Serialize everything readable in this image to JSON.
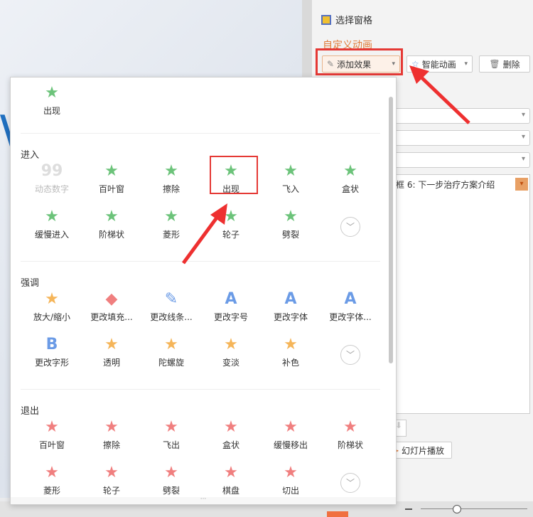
{
  "panel": {
    "select_pane": "选择窗格",
    "custom_animation": "自定义动画",
    "add_effect": "添加效果",
    "smart_animation": "智能动画",
    "delete": "删除",
    "list_item": "框 6: 下一步治疗方案介绍",
    "slideshow": "幻灯片播放"
  },
  "dropdown": {
    "recent": [
      {
        "label": "出现",
        "icon": "star",
        "color": "#6cc37a"
      }
    ],
    "sections": [
      {
        "title": "进入",
        "items": [
          {
            "label": "动态数字",
            "icon": "99"
          },
          {
            "label": "百叶窗",
            "icon": "star"
          },
          {
            "label": "擦除",
            "icon": "star"
          },
          {
            "label": "出现",
            "icon": "star",
            "highlight": true
          },
          {
            "label": "飞入",
            "icon": "star"
          },
          {
            "label": "盒状",
            "icon": "star"
          },
          {
            "label": "缓慢进入",
            "icon": "star"
          },
          {
            "label": "阶梯状",
            "icon": "star"
          },
          {
            "label": "菱形",
            "icon": "star"
          },
          {
            "label": "轮子",
            "icon": "star"
          },
          {
            "label": "劈裂",
            "icon": "star"
          }
        ]
      },
      {
        "title": "强调",
        "items": [
          {
            "label": "放大/缩小",
            "icon": "star"
          },
          {
            "label": "更改填充...",
            "icon": "fill"
          },
          {
            "label": "更改线条...",
            "icon": "pen"
          },
          {
            "label": "更改字号",
            "icon": "A"
          },
          {
            "label": "更改字体",
            "icon": "A"
          },
          {
            "label": "更改字体...",
            "icon": "A"
          },
          {
            "label": "更改字形",
            "icon": "B"
          },
          {
            "label": "透明",
            "icon": "star"
          },
          {
            "label": "陀螺旋",
            "icon": "star"
          },
          {
            "label": "变淡",
            "icon": "star"
          },
          {
            "label": "补色",
            "icon": "star"
          }
        ]
      },
      {
        "title": "退出",
        "items": [
          {
            "label": "百叶窗",
            "icon": "star"
          },
          {
            "label": "擦除",
            "icon": "star"
          },
          {
            "label": "飞出",
            "icon": "star"
          },
          {
            "label": "盒状",
            "icon": "star"
          },
          {
            "label": "缓慢移出",
            "icon": "star"
          },
          {
            "label": "阶梯状",
            "icon": "star"
          },
          {
            "label": "菱形",
            "icon": "star"
          },
          {
            "label": "轮子",
            "icon": "star"
          },
          {
            "label": "劈裂",
            "icon": "star"
          },
          {
            "label": "棋盘",
            "icon": "star"
          },
          {
            "label": "切出",
            "icon": "star"
          }
        ]
      }
    ],
    "more_icon": "chevron-down-icon",
    "footer": "···"
  },
  "colors": {
    "enter": "#6cc37a",
    "emphasis": "#f5b559",
    "exit": "#f07f7f",
    "highlight": "#e53935",
    "accent": "#e07b39"
  }
}
